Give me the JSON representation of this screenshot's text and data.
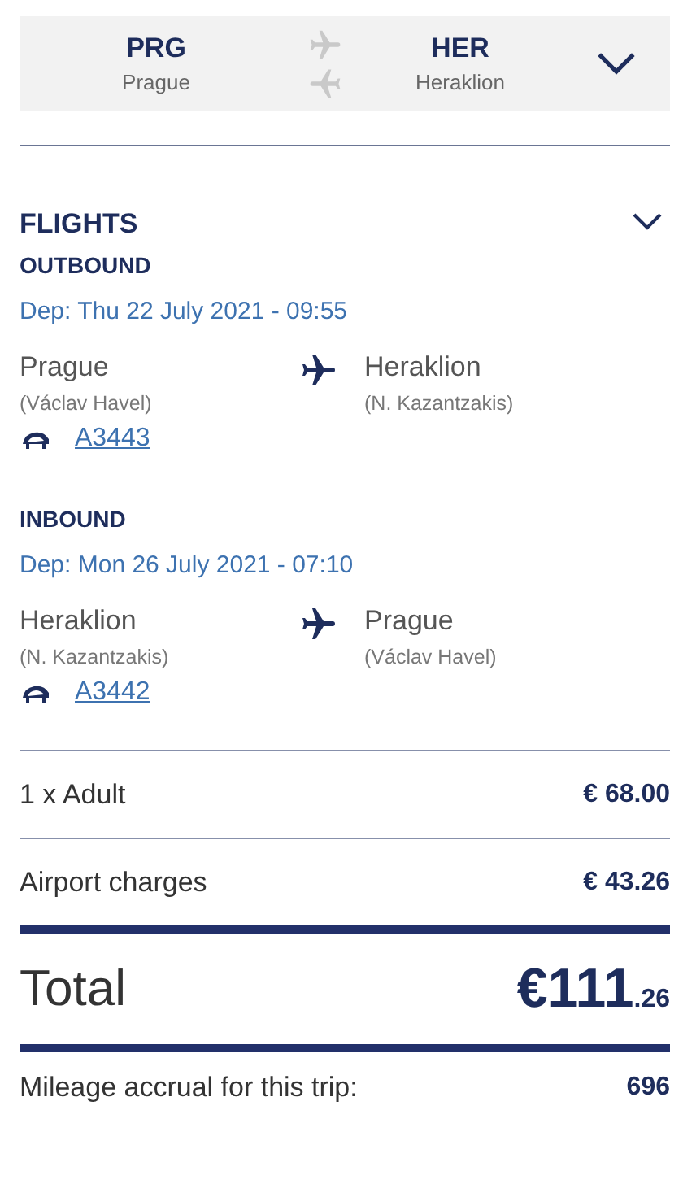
{
  "route": {
    "origin": {
      "code": "PRG",
      "city": "Prague"
    },
    "destination": {
      "code": "HER",
      "city": "Heraklion"
    }
  },
  "flights": {
    "title": "FLIGHTS",
    "legs": [
      {
        "label": "OUTBOUND",
        "departure": "Dep: Thu 22 July 2021 - 09:55",
        "from": {
          "city": "Prague",
          "airport": "(Václav Havel)"
        },
        "to": {
          "city": "Heraklion",
          "airport": "(N. Kazantzakis)"
        },
        "flight_number": "A3443"
      },
      {
        "label": "INBOUND",
        "departure": "Dep: Mon 26 July 2021 - 07:10",
        "from": {
          "city": "Heraklion",
          "airport": "(N. Kazantzakis)"
        },
        "to": {
          "city": "Prague",
          "airport": "(Václav Havel)"
        },
        "flight_number": "A3442"
      }
    ]
  },
  "price": {
    "items": [
      {
        "label": "1 x Adult",
        "amount": "€ 68.00"
      },
      {
        "label": "Airport charges",
        "amount": "€ 43.26"
      }
    ],
    "total": {
      "label": "Total",
      "amount": "€111",
      "cents": ".26"
    },
    "mileage": {
      "label": "Mileage accrual for this trip:",
      "value": "696"
    }
  }
}
